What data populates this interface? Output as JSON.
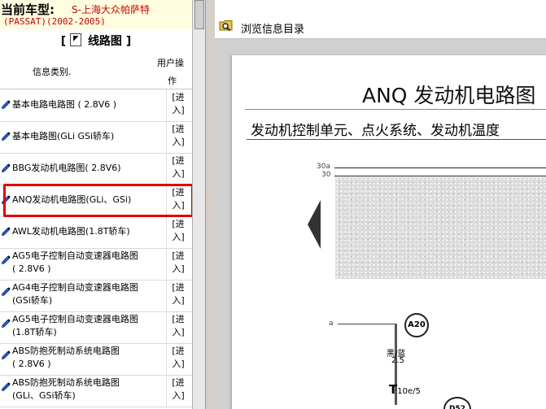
{
  "left_panel": {
    "car_label": "当前车型:",
    "car_value": "S-上海大众帕萨特",
    "car_years": "(PASSAT)(2002-2005)",
    "section_title": "线路图",
    "section_bracket_open": "[",
    "section_bracket_close": "]",
    "header_category": "信息类别.",
    "header_op_line1": "用户操",
    "header_op_line2": "作",
    "enter_line1": "[进",
    "enter_line2": "入]",
    "items": [
      {
        "line1": "基本电路电路图 ( 2.8V6 )",
        "line2": ""
      },
      {
        "line1": "基本电路图(GLi GSi轿车)",
        "line2": ""
      },
      {
        "line1": "BBG发动机电路图( 2.8V6)",
        "line2": ""
      },
      {
        "line1": "ANQ发动机电路图(GLi、GSi)",
        "line2": ""
      },
      {
        "line1": "AWL发动机电路图(1.8T轿车)",
        "line2": ""
      },
      {
        "line1": "AG5电子控制自动变速器电路图",
        "line2": "( 2.8V6 )"
      },
      {
        "line1": "AG4电子控制自动变速器电路图",
        "line2": "(GSi轿车)"
      },
      {
        "line1": "AG5电子控制自动变速器电路图",
        "line2": "(1.8T轿车)"
      },
      {
        "line1": "ABS防抱死制动系统电路图",
        "line2": "( 2.8V6 )"
      },
      {
        "line1": "ABS防抱死制动系统电路图",
        "line2": "(GLi、GSi轿车)"
      }
    ]
  },
  "right_panel": {
    "toolbar_label": "浏览信息目录",
    "doc_title": "ANQ 发动机电路图",
    "doc_subtitle": "发动机控制单元、点火系统、发动机温度",
    "rail_30a": "30a",
    "rail_30": "30",
    "wire_a": "a",
    "node_a20": "A20",
    "wire_color": "黑/蓝",
    "wire_gauge": "2.5",
    "conn_t": "T",
    "conn_t_sub": "10e/5",
    "node_d52": "D52"
  },
  "colors": {
    "highlight": "#e00000",
    "car_value": "#cc0000",
    "header_bg": "#fffde0"
  }
}
